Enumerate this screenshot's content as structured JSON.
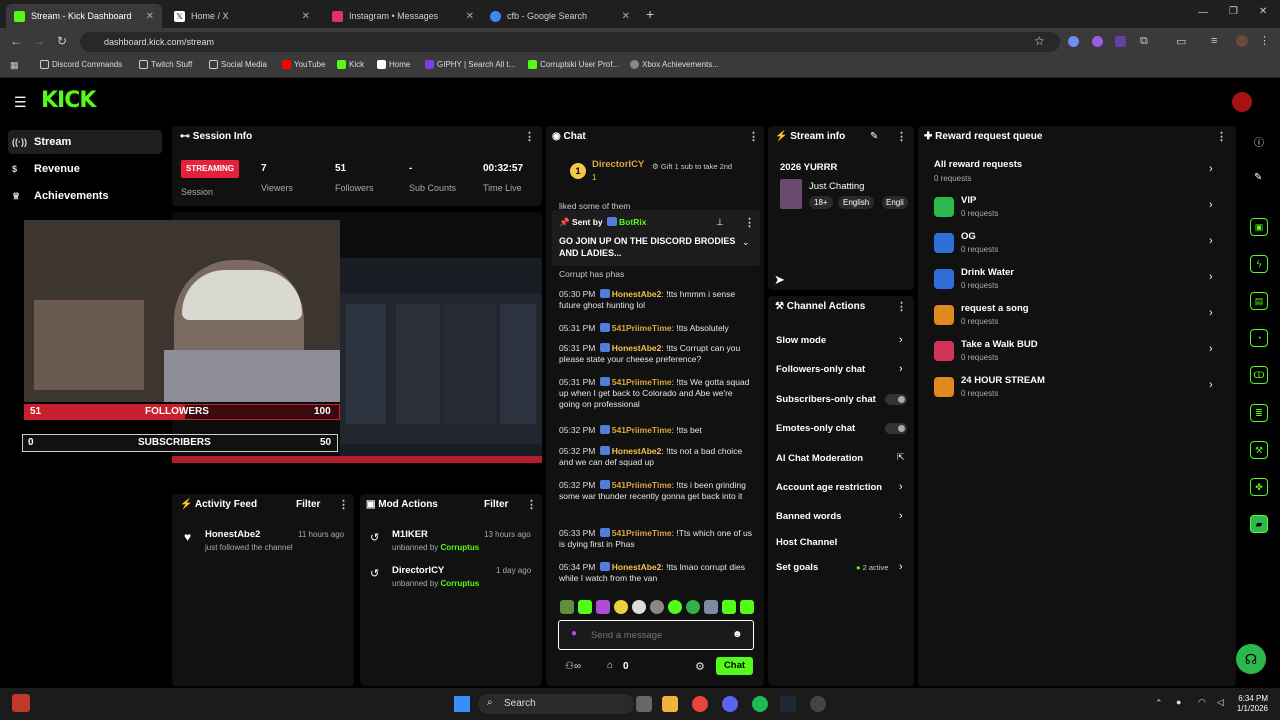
{
  "browser": {
    "tabs": [
      {
        "title": "Stream - Kick Dashboard",
        "color": "#53fc18"
      },
      {
        "title": "Home / X",
        "color": "#ffffff"
      },
      {
        "title": "Instagram • Messages",
        "color": "#e1306c"
      },
      {
        "title": "cfb - Google Search",
        "color": "#4285f4"
      }
    ],
    "url": "dashboard.kick.com/stream",
    "bookmarks": [
      "Discord Commands",
      "Twitch Stuff",
      "Social Media",
      "YouTube",
      "Kick",
      "Home",
      "GIPHY | Search All t...",
      "Corruptski User Prof...",
      "Xbox Achievements..."
    ]
  },
  "kick": {
    "logo": "KICK",
    "accent": "#53fc18",
    "nav": [
      {
        "label": "Stream",
        "icon": "broadcast-icon"
      },
      {
        "label": "Revenue",
        "icon": "dollar-icon"
      },
      {
        "label": "Achievements",
        "icon": "trophy-icon"
      }
    ],
    "session": {
      "title": "Session Info",
      "status": "STREAMING",
      "status_label": "Session",
      "stats": [
        {
          "value": "7",
          "label": "Viewers"
        },
        {
          "value": "51",
          "label": "Followers"
        },
        {
          "value": "-",
          "label": "Sub Counts"
        },
        {
          "value": "00:32:57",
          "label": "Time Live"
        }
      ]
    },
    "preview": {
      "followers_count": "51",
      "followers_label": "FOLLOWERS",
      "followers_goal": "100",
      "subs_count": "0",
      "subs_label": "SUBSCRIBERS",
      "subs_goal": "50",
      "followers_progress": 0.51,
      "subs_progress": 0.0
    },
    "activity": {
      "title": "Activity Feed",
      "filter": "Filter",
      "items": [
        {
          "user": "HonestAbe2",
          "text": "just followed the channel",
          "time": "11 hours ago"
        }
      ]
    },
    "mod": {
      "title": "Mod Actions",
      "filter": "Filter",
      "items": [
        {
          "user": "M1IKER",
          "text": "unbanned by",
          "by": "Corruptus",
          "time": "13 hours ago"
        },
        {
          "user": "DirectorICY",
          "text": "unbanned by",
          "by": "Corruptus",
          "time": "1 day ago"
        }
      ]
    },
    "chat": {
      "title": "Chat",
      "gifter": "DirectorICY",
      "gifter_count": "1",
      "gift_text": "Gift 1 sub to take 2nd",
      "cut_text": "liked some of them",
      "pinned_by_label": "Sent by",
      "pinned_user": "BotRix",
      "pinned_msg": "GO JOIN UP ON THE DISCORD BRODIES AND LADIES...",
      "cut2": "Corrupt has phas",
      "messages": [
        {
          "time": "05:30 PM",
          "user": "HonestAbe2",
          "text": "!tts hmmm i sense future ghost hunting lol"
        },
        {
          "time": "05:31 PM",
          "user": "541PriimeTime",
          "text": "!tts Absolutely"
        },
        {
          "time": "05:31 PM",
          "user": "HonestAbe2",
          "text": "!tts Corrupt can you please state your cheese preference?"
        },
        {
          "time": "05:31 PM",
          "user": "541PriimeTime",
          "text": "!tts We gotta squad up when I get back to Colorado and Abe we're going on professional"
        },
        {
          "time": "05:32 PM",
          "user": "541PriimeTime",
          "text": "!tts bet"
        },
        {
          "time": "05:32 PM",
          "user": "HonestAbe2",
          "text": "!tts not a bad choice and we can def squad up"
        },
        {
          "time": "05:32 PM",
          "user": "541PriimeTime",
          "text": "!tts i been grinding some war thunder recently gonna get back into it"
        },
        {
          "time": "05:33 PM",
          "user": "541PriimeTime",
          "text": "!Tts which one of us is dying first in Phas"
        },
        {
          "time": "05:34 PM",
          "user": "HonestAbe2",
          "text": "!tts lmao corrupt dies while I watch from the van"
        }
      ],
      "placeholder": "Send a message",
      "points": "0",
      "send_label": "Chat"
    },
    "stream_info": {
      "title": "Stream info",
      "stream_title": "2026 YURRR",
      "category": "Just Chatting",
      "tags": [
        "18+",
        "English",
        "Engli"
      ]
    },
    "channel_actions": {
      "title": "Channel Actions",
      "items": [
        {
          "label": "Slow mode",
          "control": "chevron"
        },
        {
          "label": "Followers-only chat",
          "control": "chevron"
        },
        {
          "label": "Subscribers-only chat",
          "control": "toggle"
        },
        {
          "label": "Emotes-only chat",
          "control": "toggle"
        },
        {
          "label": "AI Chat Moderation",
          "control": "external"
        },
        {
          "label": "Account age restriction",
          "control": "chevron"
        },
        {
          "label": "Banned words",
          "control": "chevron"
        },
        {
          "label": "Host Channel",
          "control": "none"
        },
        {
          "label": "Set goals",
          "control": "chevron",
          "badge": "2 active"
        }
      ]
    },
    "rewards": {
      "title": "Reward request queue",
      "all_label": "All reward requests",
      "all_count": "0 requests",
      "items": [
        {
          "name": "VIP",
          "count": "0 requests",
          "color": "#2db84d"
        },
        {
          "name": "OG",
          "count": "0 requests",
          "color": "#2f6fd6"
        },
        {
          "name": "Drink Water",
          "count": "0 requests",
          "color": "#2f6fd6"
        },
        {
          "name": "request a song",
          "count": "0 requests",
          "color": "#e08a1e"
        },
        {
          "name": "Take a Walk BUD",
          "count": "0 requests",
          "color": "#d6335c"
        },
        {
          "name": "24 HOUR STREAM",
          "count": "0 requests",
          "color": "#e08a1e"
        }
      ]
    }
  },
  "taskbar": {
    "search": "Search",
    "time": "6:34 PM",
    "date": "1/1/2026"
  }
}
